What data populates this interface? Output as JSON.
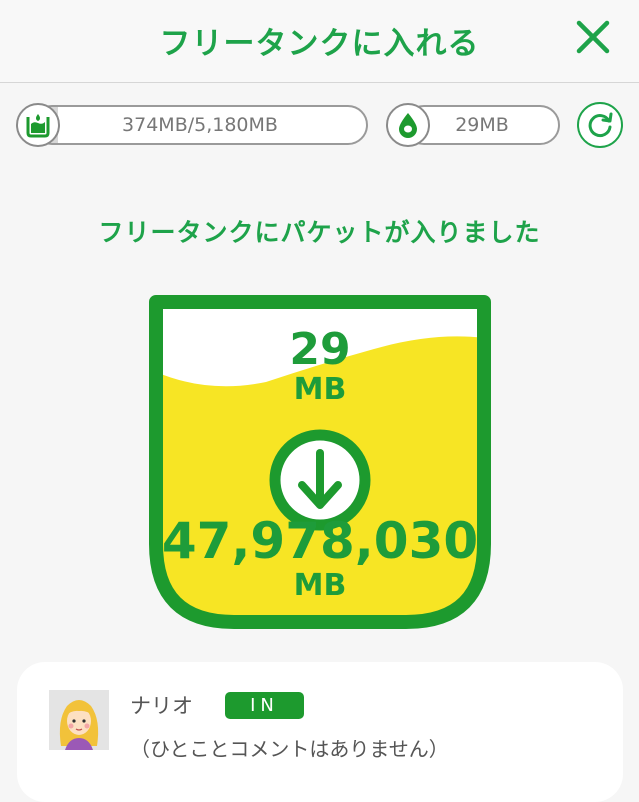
{
  "header": {
    "title": "フリータンクに入れる",
    "close_icon": "close-icon"
  },
  "gauges": {
    "tank_capacity": {
      "text": "374MB/5,180MB",
      "used_fraction": 0.072,
      "icon": "tank-icon"
    },
    "my_packet": {
      "text": "29MB",
      "icon": "drop-icon"
    },
    "refresh_icon": "refresh-icon"
  },
  "status_message": "フリータンクにパケットが入りました",
  "tank": {
    "added_value": "29",
    "added_unit": "MB",
    "total_value": "47,978,030",
    "total_unit": "MB",
    "arrow_icon": "arrow-down-icon"
  },
  "user_card": {
    "name": "ナリオ",
    "badge": "IN",
    "comment": "（ひとことコメントはありません）",
    "avatar_icon": "avatar"
  },
  "colors": {
    "accent_green": "#1ea34a",
    "tank_border": "#1d9a2e",
    "tank_fill": "#f7e524",
    "background": "#f6f6f6"
  }
}
